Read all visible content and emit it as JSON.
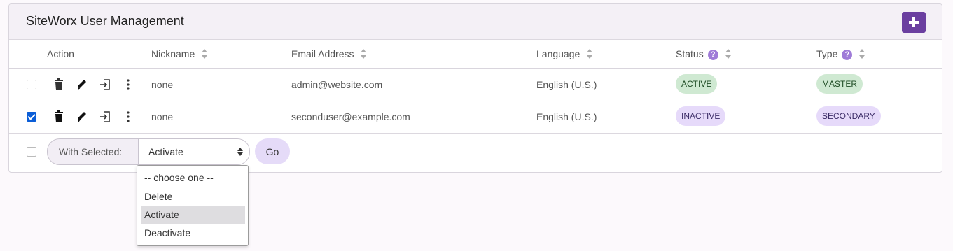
{
  "header": {
    "title": "SiteWorx User Management"
  },
  "columns": {
    "action": "Action",
    "nickname": "Nickname",
    "email": "Email Address",
    "language": "Language",
    "status": "Status",
    "type": "Type"
  },
  "help_glyph": "?",
  "users": [
    {
      "checked": false,
      "nickname": "none",
      "email": "admin@website.com",
      "language": "English (U.S.)",
      "status": "ACTIVE",
      "type": "MASTER"
    },
    {
      "checked": true,
      "nickname": "none",
      "email": "seconduser@example.com",
      "language": "English (U.S.)",
      "status": "INACTIVE",
      "type": "SECONDARY"
    }
  ],
  "bulk": {
    "label": "With Selected:",
    "selected_value": "Activate",
    "go_label": "Go",
    "options": [
      "-- choose one --",
      "Delete",
      "Activate",
      "Deactivate"
    ]
  },
  "icons": [
    "plus-icon",
    "sort-icon",
    "help-icon",
    "trash-icon",
    "pencil-icon",
    "login-icon",
    "kebab-icon"
  ],
  "colors": {
    "accent": "#6b3fa0",
    "active_badge": "#cfe9d2",
    "inactive_badge": "#e6dafa",
    "checkbox": "#0b5ed7"
  }
}
